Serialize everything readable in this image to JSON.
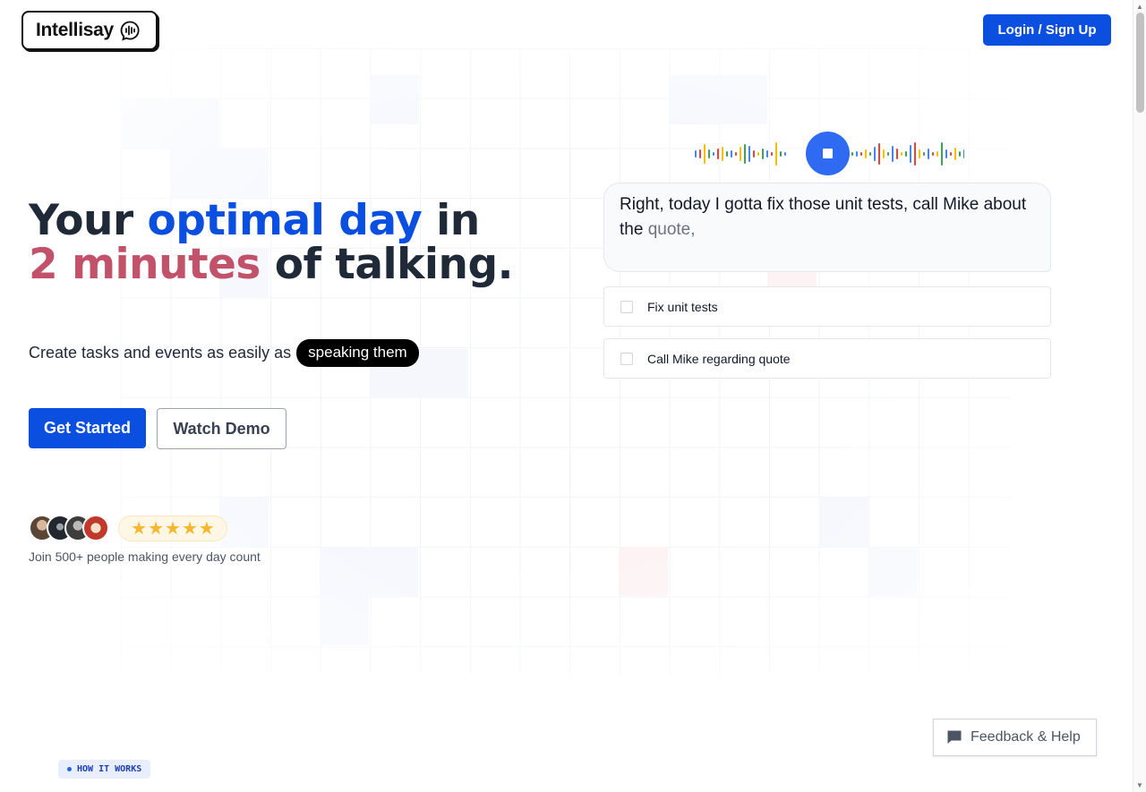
{
  "header": {
    "logo_text": "Intellisay",
    "logo_icon": "speaking-head-icon",
    "login_label": "Login / Sign Up"
  },
  "hero": {
    "headline": {
      "part1": "Your ",
      "part2": "optimal day",
      "part3": " in",
      "part4": "2 minutes",
      "part5": " of talking."
    },
    "subline": "Create tasks and events as easily as",
    "subline_pill": "speaking them",
    "primary_cta": "Get Started",
    "secondary_cta": "Watch Demo",
    "rating_stars": 5,
    "social_proof": "Join 500+ people making every day count"
  },
  "demo": {
    "transcript_main": "Right, today I gotta fix those unit tests, call Mike about the",
    "transcript_pending": "quote,",
    "tasks": [
      {
        "label": "Fix unit tests",
        "checked": false
      },
      {
        "label": "Call Mike regarding quote",
        "checked": false
      }
    ],
    "wave_colors": [
      "#4285f4",
      "#ea4335",
      "#fbbc05",
      "#34a853"
    ]
  },
  "bottom": {
    "how_it_works": "HOW IT WORKS",
    "feedback_label": "Feedback & Help"
  },
  "colors": {
    "accent_blue": "#0b4fe0",
    "accent_pink": "#c2516a",
    "star": "#f6b62d"
  }
}
